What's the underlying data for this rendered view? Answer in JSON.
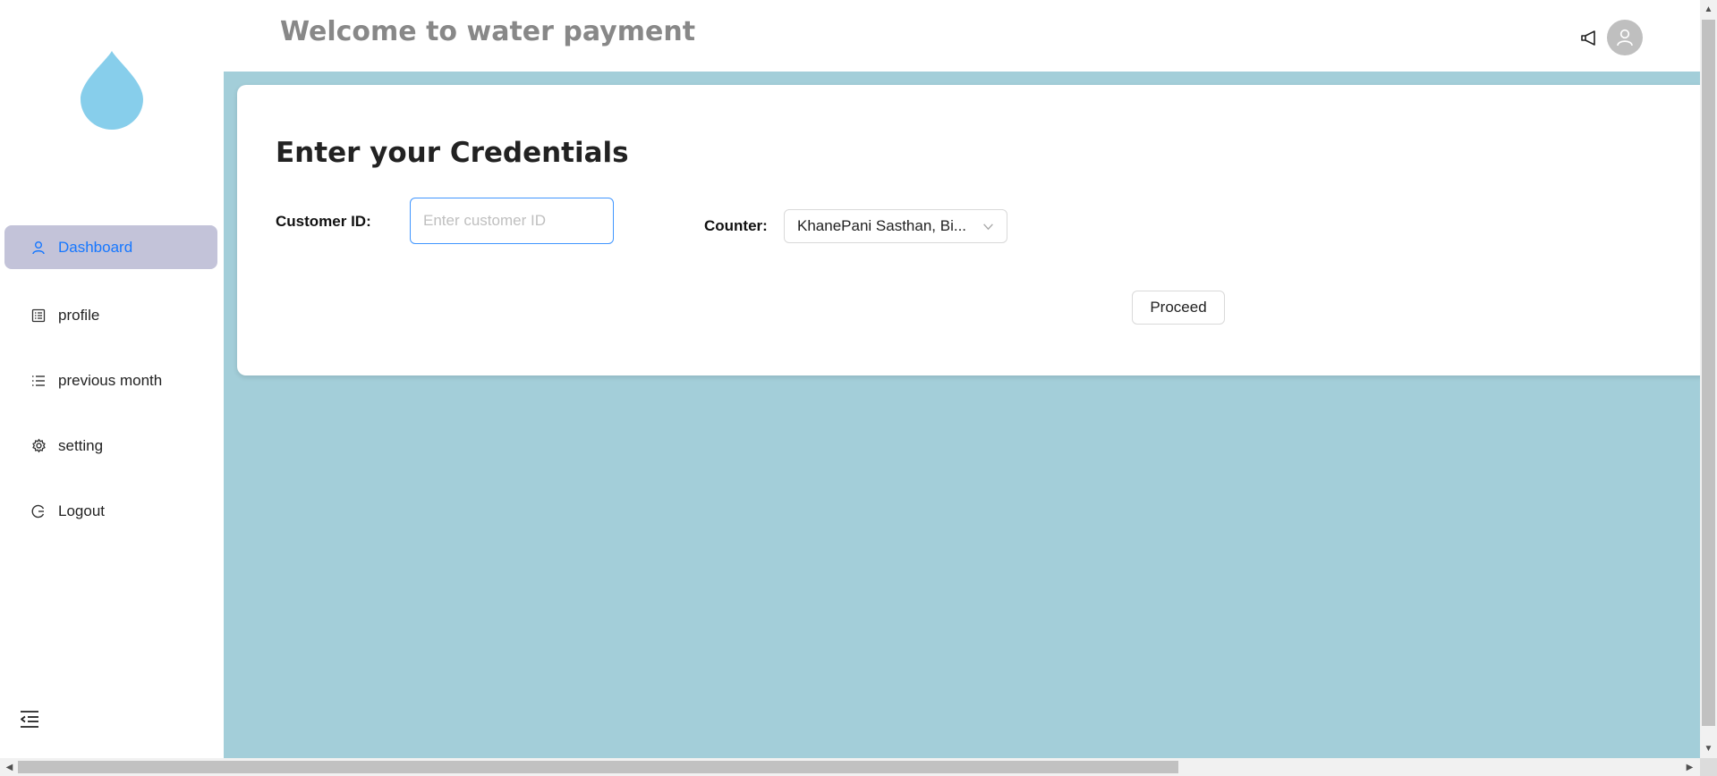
{
  "colors": {
    "brand_drop": "#87ceeb",
    "content_bg": "#a3ced9",
    "active_nav_bg": "#c3c3d9",
    "active_nav_text": "#1677ff",
    "input_focus_border": "#4096ff"
  },
  "header": {
    "title": "Welcome to water payment",
    "notification_icon": "megaphone-icon",
    "avatar_icon": "user-icon"
  },
  "sidebar": {
    "logo_icon": "water-drop-icon",
    "items": [
      {
        "label": "Dashboard",
        "icon": "user-icon",
        "active": true
      },
      {
        "label": "profile",
        "icon": "profile-icon",
        "active": false
      },
      {
        "label": "previous month",
        "icon": "list-icon",
        "active": false
      },
      {
        "label": "setting",
        "icon": "gear-icon",
        "active": false
      },
      {
        "label": "Logout",
        "icon": "logout-icon",
        "active": false
      }
    ],
    "collapse_icon": "menu-fold-icon"
  },
  "form": {
    "title": "Enter your Credentials",
    "customer_id_label": "Customer ID:",
    "customer_id_placeholder": "Enter customer ID",
    "customer_id_value": "",
    "counter_label": "Counter:",
    "counter_value": "KhanePani Sasthan, Bi...",
    "proceed_label": "Proceed"
  }
}
